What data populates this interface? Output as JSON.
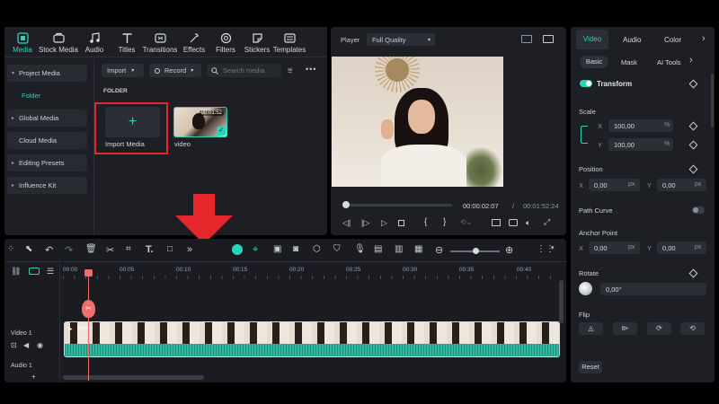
{
  "toolbar": {
    "items": [
      {
        "label": "Media",
        "icon": "media-icon"
      },
      {
        "label": "Stock Media",
        "icon": "stock-media-icon"
      },
      {
        "label": "Audio",
        "icon": "audio-icon"
      },
      {
        "label": "Titles",
        "icon": "titles-icon"
      },
      {
        "label": "Transitions",
        "icon": "transitions-icon"
      },
      {
        "label": "Effects",
        "icon": "effects-icon"
      },
      {
        "label": "Filters",
        "icon": "filters-icon"
      },
      {
        "label": "Stickers",
        "icon": "stickers-icon"
      },
      {
        "label": "Templates",
        "icon": "templates-icon"
      }
    ]
  },
  "media_nav": {
    "items": [
      "Project Media",
      "Folder",
      "Global Media",
      "Cloud Media",
      "Editing Presets",
      "Influence Kit"
    ]
  },
  "media_panel": {
    "import_label": "Import",
    "record_label": "Record",
    "search_placeholder": "Search media",
    "folder_heading": "FOLDER",
    "import_tile_label": "Import Media",
    "clip_name": "video",
    "clip_duration": "00:01:52"
  },
  "player": {
    "label": "Player",
    "quality": "Full Quality",
    "current_time": "00:00:02:07",
    "total_time": "00:01:52:24"
  },
  "timeline": {
    "ruler": [
      "00:00",
      "00:05",
      "00:10",
      "00:15",
      "00:20",
      "00:25",
      "00:30",
      "00:35",
      "00:40"
    ],
    "video_track": "Video 1",
    "audio_track": "Audio 1",
    "clip_label": "video"
  },
  "inspector": {
    "tabs": [
      "Video",
      "Audio",
      "Color"
    ],
    "subtabs": [
      "Basic",
      "Mask",
      "AI Tools"
    ],
    "transform_label": "Transform",
    "scale_label": "Scale",
    "scale_x": "100,00",
    "scale_y": "100,00",
    "percent": "%",
    "position_label": "Position",
    "pos_x": "0,00",
    "pos_y": "0,00",
    "px": "px",
    "path_curve_label": "Path Curve",
    "anchor_label": "Anchor Point",
    "anchor_x": "0,00",
    "anchor_y": "0,00",
    "rotate_label": "Rotate",
    "rotate_value": "0,00°",
    "flip_label": "Flip",
    "reset_label": "Reset",
    "x_letter": "X",
    "y_letter": "Y"
  },
  "colors": {
    "accent": "#27d6b9",
    "highlight_box": "#e5272b",
    "arrow": "#e5272b",
    "playhead": "#f26d6d",
    "audio_wave": "#2fb7a0"
  }
}
